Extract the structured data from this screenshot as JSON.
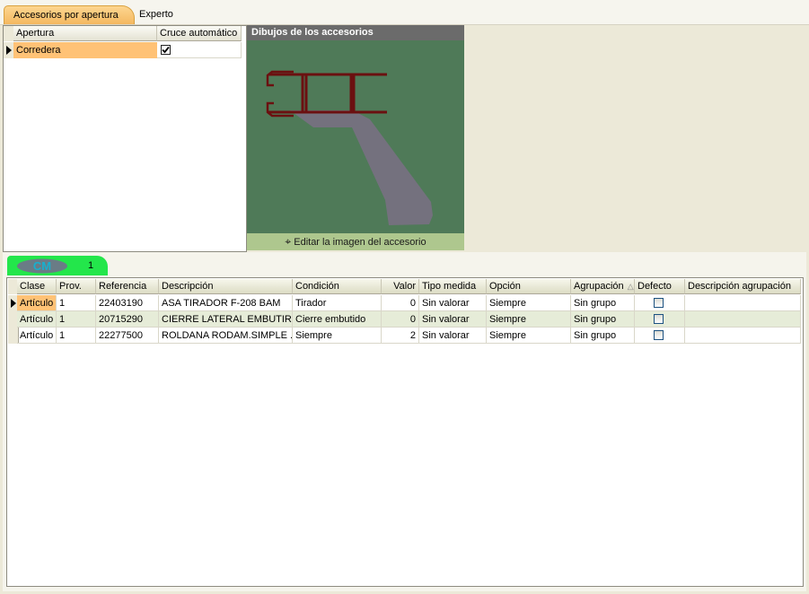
{
  "tabs": [
    "Accesorios por apertura",
    "Experto"
  ],
  "apertura_grid": {
    "columns": [
      "Apertura",
      "Cruce automático"
    ],
    "rows": [
      {
        "apertura": "Corredera",
        "cruce": true
      }
    ]
  },
  "picture": {
    "title": "Dibujos de los accesorios",
    "edit_label": "Editar la imagen del accesorio"
  },
  "group_tab": {
    "logo_text": "CM",
    "count": "1"
  },
  "accesorios_grid": {
    "columns": [
      "Clase",
      "Prov.",
      "Referencia",
      "Descripción",
      "Condición",
      "Valor",
      "Tipo medida",
      "Opción",
      "Agrupación",
      "Defecto",
      "Descripción agrupación"
    ],
    "rows": [
      {
        "clase": "Artículo",
        "prov": "1",
        "referencia": "22403190",
        "descripcion": "ASA TIRADOR F-208 BAM",
        "condicion": "Tirador",
        "valor": "0",
        "tipo_medida": "Sin valorar",
        "opcion": "Siempre",
        "agrupacion": "Sin grupo",
        "defecto": false,
        "desc_agrupacion": ""
      },
      {
        "clase": "Artículo",
        "prov": "1",
        "referencia": "20715290",
        "descripcion": "CIERRE LATERAL EMBUTIR...",
        "condicion": "Cierre embutido",
        "valor": "0",
        "tipo_medida": "Sin valorar",
        "opcion": "Siempre",
        "agrupacion": "Sin grupo",
        "defecto": false,
        "desc_agrupacion": ""
      },
      {
        "clase": "Artículo",
        "prov": "1",
        "referencia": "22277500",
        "descripcion": "ROLDANA RODAM.SIMPLE ...",
        "condicion": "Siempre",
        "valor": "2",
        "tipo_medida": "Sin valorar",
        "opcion": "Siempre",
        "agrupacion": "Sin grupo",
        "defecto": false,
        "desc_agrupacion": ""
      }
    ]
  },
  "colors": {
    "active_tab": "#f4b860",
    "selected_cell": "#ffc276",
    "picture_bg": "#4f7a58",
    "group_tab": "#23e64b"
  }
}
